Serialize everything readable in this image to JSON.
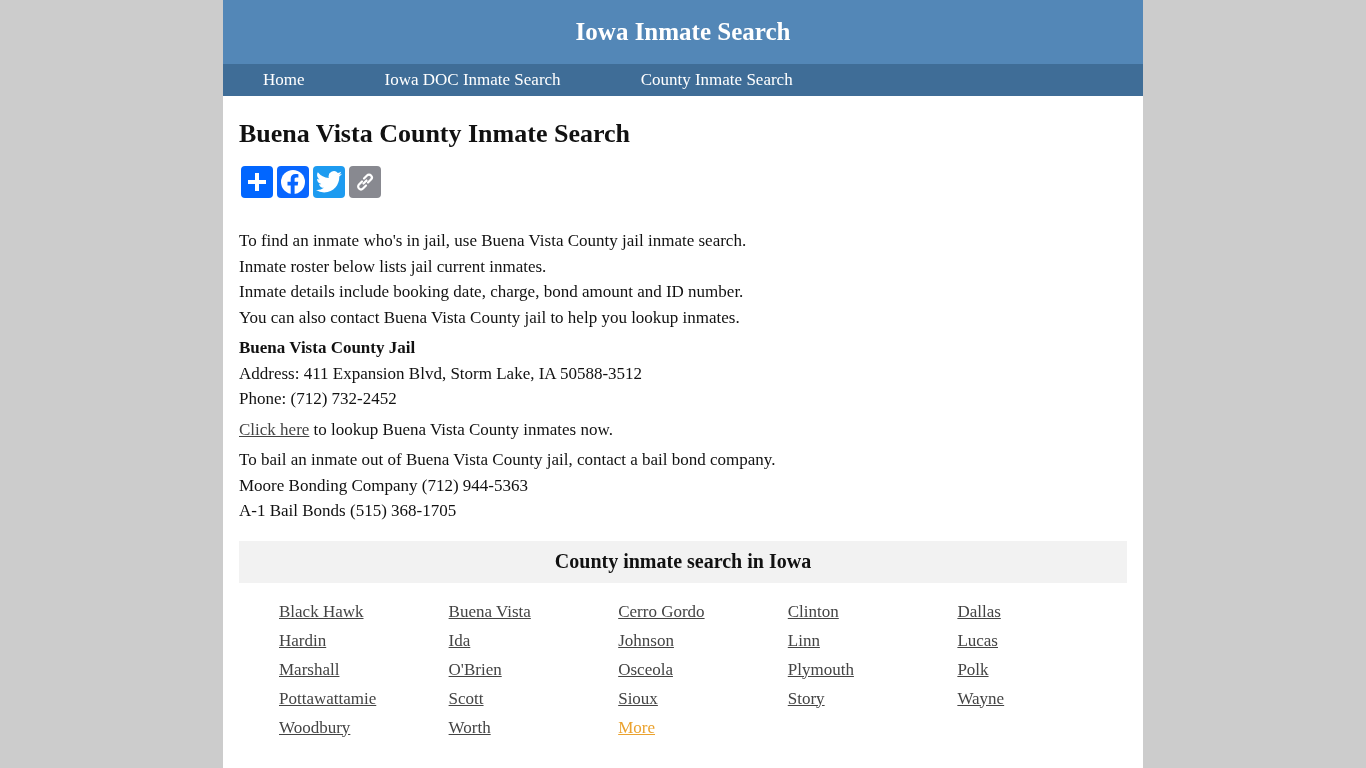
{
  "header": {
    "title": "Iowa Inmate Search"
  },
  "nav": [
    {
      "label": "Home"
    },
    {
      "label": "Iowa DOC Inmate Search"
    },
    {
      "label": "County Inmate Search"
    }
  ],
  "page_title": "Buena Vista County Inmate Search",
  "intro": [
    "To find an inmate who's in jail, use Buena Vista County jail inmate search.",
    "Inmate roster below lists jail current inmates.",
    "Inmate details include booking date, charge, bond amount and ID number.",
    "You can also contact Buena Vista County jail to help you lookup inmates."
  ],
  "jail": {
    "name": "Buena Vista County Jail",
    "address": "Address: 411 Expansion Blvd, Storm Lake, IA 50588-3512",
    "phone": "Phone: (712) 732-2452"
  },
  "lookup": {
    "link": "Click here",
    "text": "to lookup Buena Vista County inmates now."
  },
  "bail": [
    "To bail an inmate out of Buena Vista County jail, contact a bail bond company.",
    "Moore Bonding Company (712) 944-5363",
    "A-1 Bail Bonds (515) 368-1705"
  ],
  "counties": {
    "title": "County inmate search in Iowa",
    "links": [
      {
        "label": "Black Hawk",
        "kind": "county"
      },
      {
        "label": "Buena Vista",
        "kind": "county"
      },
      {
        "label": "Cerro Gordo",
        "kind": "county"
      },
      {
        "label": "Clinton",
        "kind": "county"
      },
      {
        "label": "Dallas",
        "kind": "county"
      },
      {
        "label": "Hardin",
        "kind": "county"
      },
      {
        "label": "Ida",
        "kind": "county"
      },
      {
        "label": "Johnson",
        "kind": "county"
      },
      {
        "label": "Linn",
        "kind": "county"
      },
      {
        "label": "Lucas",
        "kind": "county"
      },
      {
        "label": "Marshall",
        "kind": "county"
      },
      {
        "label": "O'Brien",
        "kind": "county"
      },
      {
        "label": "Osceola",
        "kind": "county"
      },
      {
        "label": "Plymouth",
        "kind": "county"
      },
      {
        "label": "Polk",
        "kind": "county"
      },
      {
        "label": "Pottawattamie",
        "kind": "county"
      },
      {
        "label": "Scott",
        "kind": "county"
      },
      {
        "label": "Sioux",
        "kind": "county"
      },
      {
        "label": "Story",
        "kind": "county"
      },
      {
        "label": "Wayne",
        "kind": "county"
      },
      {
        "label": "Woodbury",
        "kind": "county"
      },
      {
        "label": "Worth",
        "kind": "county"
      },
      {
        "label": "More",
        "kind": "more"
      }
    ]
  }
}
